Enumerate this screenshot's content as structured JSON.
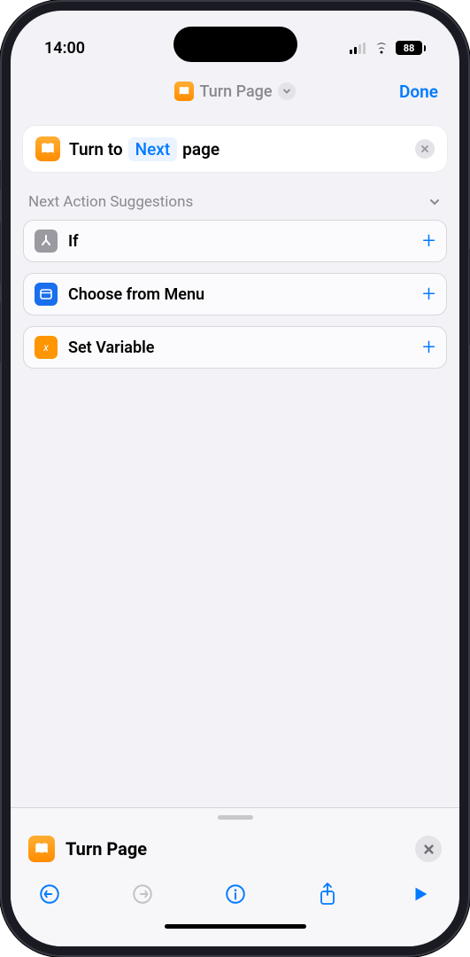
{
  "status": {
    "time": "14:00",
    "battery": "88"
  },
  "nav": {
    "title": "Turn Page",
    "done": "Done"
  },
  "action": {
    "prefix": "Turn to",
    "token": "Next",
    "suffix": "page"
  },
  "suggestions": {
    "heading": "Next Action Suggestions",
    "items": [
      {
        "label": "If"
      },
      {
        "label": "Choose from Menu"
      },
      {
        "label": "Set Variable"
      }
    ]
  },
  "sheet": {
    "title": "Turn Page"
  }
}
